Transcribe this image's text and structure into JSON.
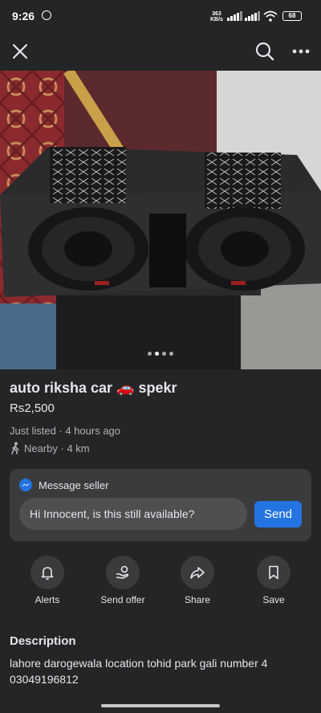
{
  "status": {
    "time": "9:26",
    "speed_top": "363",
    "speed_bottom": "KB/s",
    "battery": "68"
  },
  "header": {
    "close_icon": "close-icon",
    "search_icon": "search-icon",
    "more_icon": "more-icon"
  },
  "listing": {
    "title": "auto riksha car 🚗 spekr",
    "price": "Rs2,500",
    "listed": "Just listed · 4 hours ago",
    "location": "Nearby · 4 km",
    "photo_count": 4,
    "active_photo": 2
  },
  "message": {
    "heading": "Message seller",
    "input_value": "Hi Innocent, is this still available?",
    "send_label": "Send"
  },
  "actions": [
    {
      "label": "Alerts",
      "icon": "bell-icon"
    },
    {
      "label": "Send offer",
      "icon": "offer-icon"
    },
    {
      "label": "Share",
      "icon": "share-icon"
    },
    {
      "label": "Save",
      "icon": "bookmark-icon"
    }
  ],
  "description": {
    "heading": "Description",
    "line1": "lahore darogewala location tohid park gali number 4",
    "line2": "03049196812"
  },
  "colors": {
    "background": "#242526",
    "card": "#3a3b3c",
    "accent": "#2374e1"
  }
}
